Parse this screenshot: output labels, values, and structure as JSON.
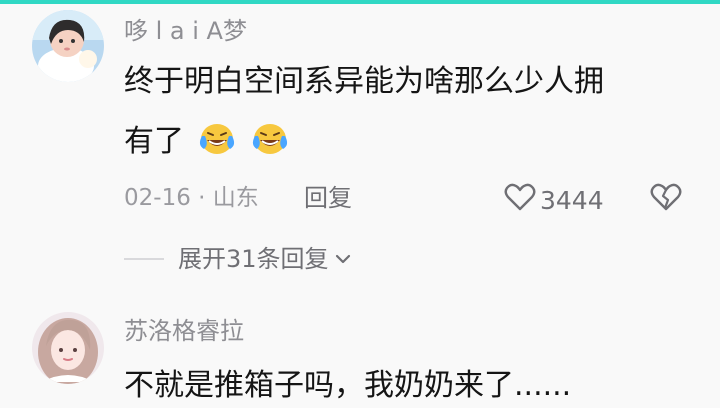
{
  "comments": [
    {
      "username": "哆 l a i A梦",
      "content_line1": "终于明白空间系异能为啥那么少人拥",
      "content_line2": "有了",
      "emojis": [
        "laughing-crying-emoji",
        "laughing-crying-emoji"
      ],
      "date_location": "02-16 · 山东",
      "reply_label": "回复",
      "like_count": "3444",
      "expand_replies": "展开31条回复"
    },
    {
      "username": "苏洛格睿拉",
      "content_line1": "不就是推箱子吗，我奶奶来了......"
    }
  ],
  "icons": {
    "like": "heart-outline-icon",
    "dislike": "broken-heart-icon",
    "expand": "chevron-down-icon"
  },
  "colors": {
    "top_accent": "#30d8c4",
    "username": "#8e8e93",
    "content": "#151515",
    "meta": "#9a9a9f"
  }
}
